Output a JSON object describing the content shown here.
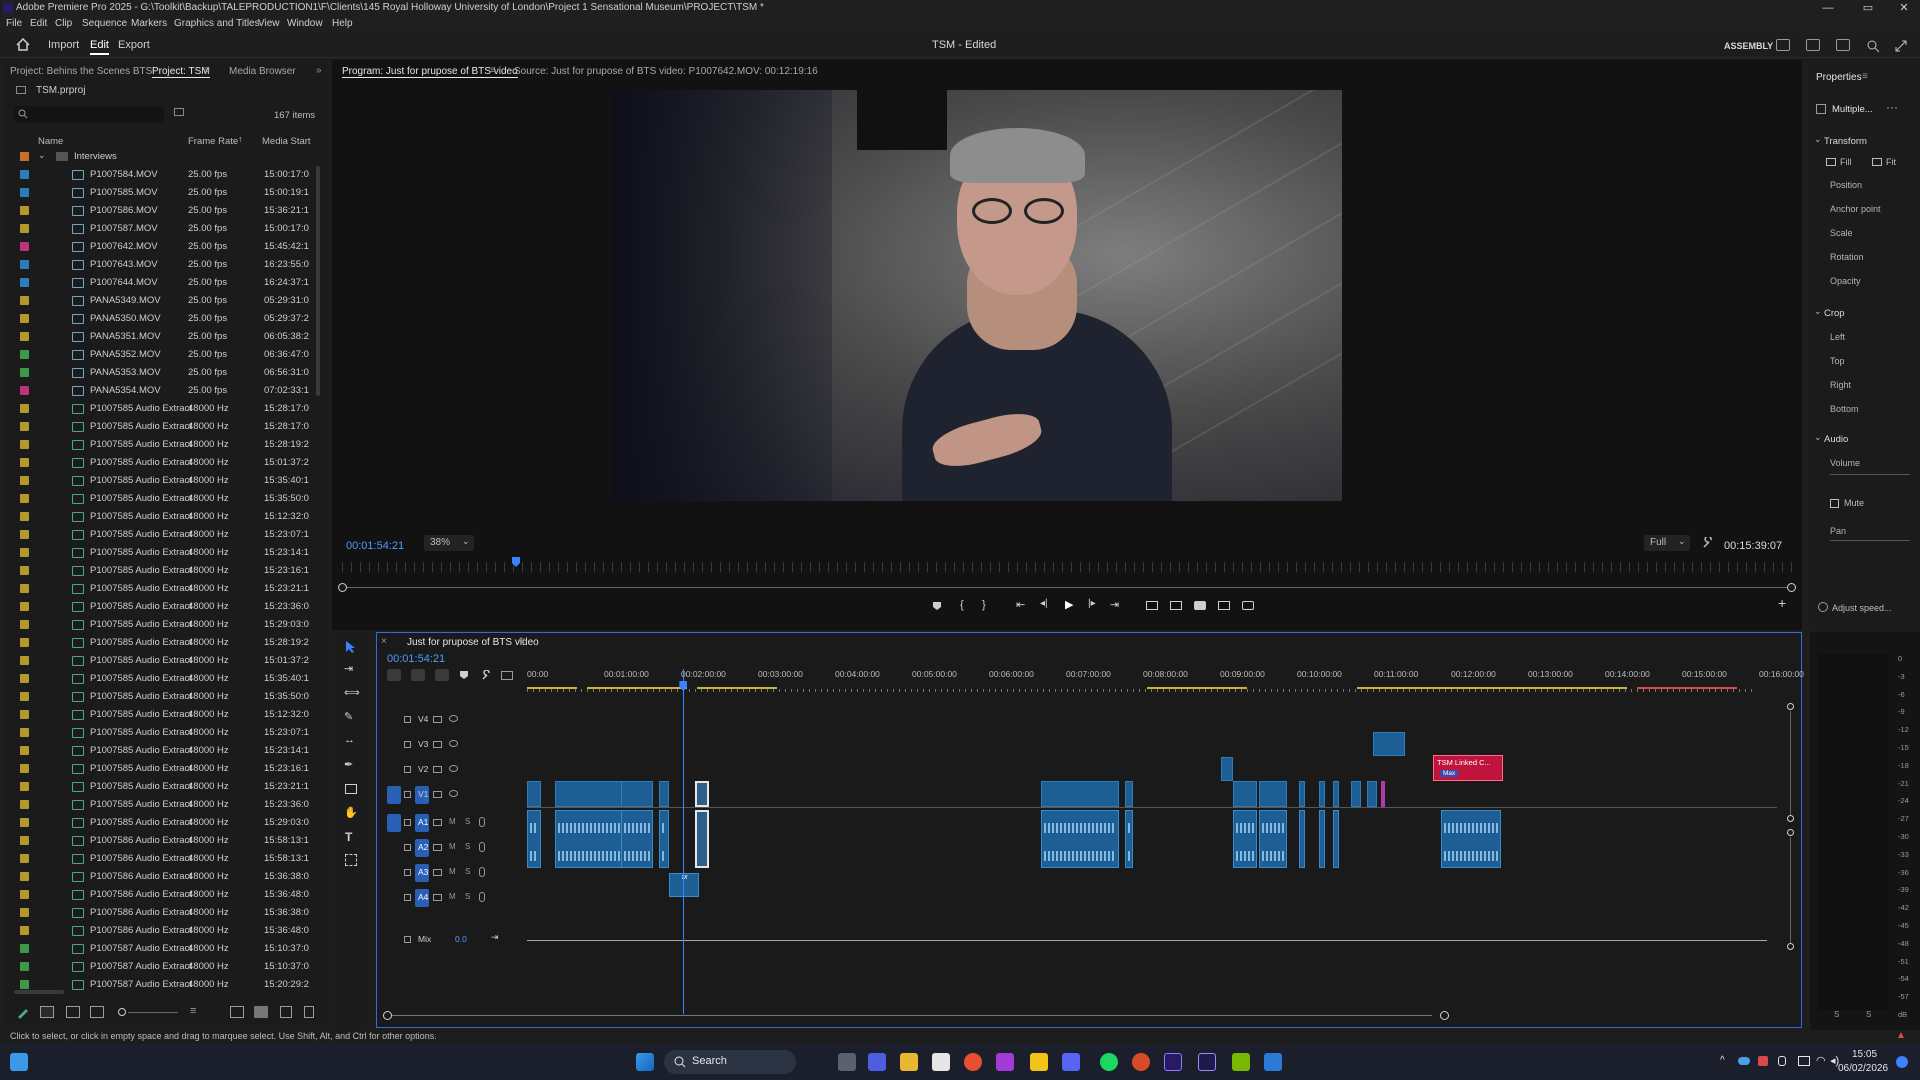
{
  "window": {
    "title": "Adobe Premiere Pro 2025 - G:\\Toolkit\\Backup\\TALEPRODUCTION1\\F\\Clients\\145 Royal Holloway University of London\\Project 1 Sensational Museum\\PROJECT\\TSM *",
    "minimize": "—",
    "maximize": "▭",
    "close": "✕"
  },
  "menu": [
    "File",
    "Edit",
    "Clip",
    "Sequence",
    "Markers",
    "Graphics and Titles",
    "View",
    "Window",
    "Help"
  ],
  "workspace": {
    "tabs": [
      "Import",
      "Edit",
      "Export"
    ],
    "active_tab": "Edit",
    "doc_title": "TSM - Edited",
    "workspace_name": "ASSEMBLY"
  },
  "project_panel": {
    "tabs": [
      "Project: Behins the Scenes BTS",
      "Project: TSM",
      "Media Browser"
    ],
    "active_tab": "Project: TSM",
    "project_file": "TSM.prproj",
    "item_count": "167 items",
    "columns": [
      "Name",
      "Frame Rate",
      "Media Start"
    ],
    "folder": "Interviews",
    "rows": [
      {
        "name": "P1007584.MOV",
        "rate": "25.00 fps",
        "start": "15:00:17:0",
        "color": "#2a7fb8",
        "type": "video"
      },
      {
        "name": "P1007585.MOV",
        "rate": "25.00 fps",
        "start": "15:00:19:1",
        "color": "#2a7fb8",
        "type": "video"
      },
      {
        "name": "P1007586.MOV",
        "rate": "25.00 fps",
        "start": "15:36:21:1",
        "color": "#b49a2a",
        "type": "video"
      },
      {
        "name": "P1007587.MOV",
        "rate": "25.00 fps",
        "start": "15:00:17:0",
        "color": "#b49a2a",
        "type": "video"
      },
      {
        "name": "P1007642.MOV",
        "rate": "25.00 fps",
        "start": "15:45:42:1",
        "color": "#c0337a",
        "type": "video"
      },
      {
        "name": "P1007643.MOV",
        "rate": "25.00 fps",
        "start": "16:23:55:0",
        "color": "#2a7fb8",
        "type": "video"
      },
      {
        "name": "P1007644.MOV",
        "rate": "25.00 fps",
        "start": "16:24:37:1",
        "color": "#2a7fb8",
        "type": "video"
      },
      {
        "name": "PANA5349.MOV",
        "rate": "25.00 fps",
        "start": "05:29:31:0",
        "color": "#b49a2a",
        "type": "video"
      },
      {
        "name": "PANA5350.MOV",
        "rate": "25.00 fps",
        "start": "05:29:37:2",
        "color": "#b49a2a",
        "type": "video"
      },
      {
        "name": "PANA5351.MOV",
        "rate": "25.00 fps",
        "start": "06:05:38:2",
        "color": "#b49a2a",
        "type": "video"
      },
      {
        "name": "PANA5352.MOV",
        "rate": "25.00 fps",
        "start": "06:36:47:0",
        "color": "#3a9a4a",
        "type": "video"
      },
      {
        "name": "PANA5353.MOV",
        "rate": "25.00 fps",
        "start": "06:56:31:0",
        "color": "#3a9a4a",
        "type": "video"
      },
      {
        "name": "PANA5354.MOV",
        "rate": "25.00 fps",
        "start": "07:02:33:1",
        "color": "#c0337a",
        "type": "video"
      },
      {
        "name": "P1007585 Audio Extract",
        "rate": "48000 Hz",
        "start": "15:28:17:0",
        "color": "#b49a2a",
        "type": "audio"
      },
      {
        "name": "P1007585 Audio Extract",
        "rate": "48000 Hz",
        "start": "15:28:17:0",
        "color": "#b49a2a",
        "type": "audio"
      },
      {
        "name": "P1007585 Audio Extract",
        "rate": "48000 Hz",
        "start": "15:28:19:2",
        "color": "#b49a2a",
        "type": "audio"
      },
      {
        "name": "P1007585 Audio Extract",
        "rate": "48000 Hz",
        "start": "15:01:37:2",
        "color": "#b49a2a",
        "type": "audio"
      },
      {
        "name": "P1007585 Audio Extract",
        "rate": "48000 Hz",
        "start": "15:35:40:1",
        "color": "#b49a2a",
        "type": "audio"
      },
      {
        "name": "P1007585 Audio Extract",
        "rate": "48000 Hz",
        "start": "15:35:50:0",
        "color": "#b49a2a",
        "type": "audio"
      },
      {
        "name": "P1007585 Audio Extract",
        "rate": "48000 Hz",
        "start": "15:12:32:0",
        "color": "#b49a2a",
        "type": "audio"
      },
      {
        "name": "P1007585 Audio Extract",
        "rate": "48000 Hz",
        "start": "15:23:07:1",
        "color": "#b49a2a",
        "type": "audio"
      },
      {
        "name": "P1007585 Audio Extract",
        "rate": "48000 Hz",
        "start": "15:23:14:1",
        "color": "#b49a2a",
        "type": "audio"
      },
      {
        "name": "P1007585 Audio Extract",
        "rate": "48000 Hz",
        "start": "15:23:16:1",
        "color": "#b49a2a",
        "type": "audio"
      },
      {
        "name": "P1007585 Audio Extract",
        "rate": "48000 Hz",
        "start": "15:23:21:1",
        "color": "#b49a2a",
        "type": "audio"
      },
      {
        "name": "P1007585 Audio Extract",
        "rate": "48000 Hz",
        "start": "15:23:36:0",
        "color": "#b49a2a",
        "type": "audio"
      },
      {
        "name": "P1007585 Audio Extract",
        "rate": "48000 Hz",
        "start": "15:29:03:0",
        "color": "#b49a2a",
        "type": "audio"
      },
      {
        "name": "P1007585 Audio Extract",
        "rate": "48000 Hz",
        "start": "15:28:19:2",
        "color": "#b49a2a",
        "type": "audio"
      },
      {
        "name": "P1007585 Audio Extract",
        "rate": "48000 Hz",
        "start": "15:01:37:2",
        "color": "#b49a2a",
        "type": "audio"
      },
      {
        "name": "P1007585 Audio Extract",
        "rate": "48000 Hz",
        "start": "15:35:40:1",
        "color": "#b49a2a",
        "type": "audio"
      },
      {
        "name": "P1007585 Audio Extract",
        "rate": "48000 Hz",
        "start": "15:35:50:0",
        "color": "#b49a2a",
        "type": "audio"
      },
      {
        "name": "P1007585 Audio Extract",
        "rate": "48000 Hz",
        "start": "15:12:32:0",
        "color": "#b49a2a",
        "type": "audio"
      },
      {
        "name": "P1007585 Audio Extract",
        "rate": "48000 Hz",
        "start": "15:23:07:1",
        "color": "#b49a2a",
        "type": "audio"
      },
      {
        "name": "P1007585 Audio Extract",
        "rate": "48000 Hz",
        "start": "15:23:14:1",
        "color": "#b49a2a",
        "type": "audio"
      },
      {
        "name": "P1007585 Audio Extract",
        "rate": "48000 Hz",
        "start": "15:23:16:1",
        "color": "#b49a2a",
        "type": "audio"
      },
      {
        "name": "P1007585 Audio Extract",
        "rate": "48000 Hz",
        "start": "15:23:21:1",
        "color": "#b49a2a",
        "type": "audio"
      },
      {
        "name": "P1007585 Audio Extract",
        "rate": "48000 Hz",
        "start": "15:23:36:0",
        "color": "#b49a2a",
        "type": "audio"
      },
      {
        "name": "P1007585 Audio Extract",
        "rate": "48000 Hz",
        "start": "15:29:03:0",
        "color": "#b49a2a",
        "type": "audio"
      },
      {
        "name": "P1007586 Audio Extract",
        "rate": "48000 Hz",
        "start": "15:58:13:1",
        "color": "#b49a2a",
        "type": "audio"
      },
      {
        "name": "P1007586 Audio Extract",
        "rate": "48000 Hz",
        "start": "15:58:13:1",
        "color": "#b49a2a",
        "type": "audio"
      },
      {
        "name": "P1007586 Audio Extract",
        "rate": "48000 Hz",
        "start": "15:36:38:0",
        "color": "#b49a2a",
        "type": "audio"
      },
      {
        "name": "P1007586 Audio Extract",
        "rate": "48000 Hz",
        "start": "15:36:48:0",
        "color": "#b49a2a",
        "type": "audio"
      },
      {
        "name": "P1007586 Audio Extract",
        "rate": "48000 Hz",
        "start": "15:36:38:0",
        "color": "#b49a2a",
        "type": "audio"
      },
      {
        "name": "P1007586 Audio Extract",
        "rate": "48000 Hz",
        "start": "15:36:48:0",
        "color": "#b49a2a",
        "type": "audio"
      },
      {
        "name": "P1007587 Audio Extract",
        "rate": "48000 Hz",
        "start": "15:10:37:0",
        "color": "#3a9a4a",
        "type": "audio"
      },
      {
        "name": "P1007587 Audio Extract",
        "rate": "48000 Hz",
        "start": "15:10:37:0",
        "color": "#3a9a4a",
        "type": "audio"
      },
      {
        "name": "P1007587 Audio Extract",
        "rate": "48000 Hz",
        "start": "15:20:29:2",
        "color": "#3a9a4a",
        "type": "audio"
      }
    ]
  },
  "program_monitor": {
    "tab": "Program: Just for prupose of BTS video",
    "source_tab": "Source: Just for prupose of BTS video: P1007642.MOV: 00:12:19:16",
    "timecode": "00:01:54:21",
    "zoom": "38%",
    "resolution": "Full",
    "duration": "00:15:39:07",
    "playhead_fraction": 0.12
  },
  "properties": {
    "title": "Properties",
    "clip": "Multiple...",
    "transform": "Transform",
    "fill": "Fill",
    "fit": "Fit",
    "position": "Position",
    "anchor": "Anchor point",
    "scale": "Scale",
    "rotation": "Rotation",
    "opacity": "Opacity",
    "crop": "Crop",
    "left": "Left",
    "top": "Top",
    "right": "Right",
    "bottom": "Bottom",
    "audio": "Audio",
    "volume": "Volume",
    "mute": "Mute",
    "pan": "Pan",
    "adjust_speed": "Adjust speed..."
  },
  "timeline": {
    "sequence_name": "Just for prupose of BTS video",
    "timecode": "00:01:54:21",
    "ruler": [
      "00:00",
      "00:01:00:00",
      "00:02:00:00",
      "00:03:00:00",
      "00:04:00:00",
      "00:05:00:00",
      "00:06:00:00",
      "00:07:00:00",
      "00:08:00:00",
      "00:09:00:00",
      "00:10:00:00",
      "00:11:00:00",
      "00:12:00:00",
      "00:13:00:00",
      "00:14:00:00",
      "00:15:00:00",
      "00:16:00:00"
    ],
    "video_tracks": [
      "V4",
      "V3",
      "V2",
      "V1"
    ],
    "audio_tracks": [
      "A1",
      "A2",
      "A3",
      "A4"
    ],
    "mix_label": "Mix",
    "mix_value": "0.0",
    "graphic_clip": "TSM Linked C...",
    "graphic_clip_sub": "Max",
    "fx_label": "fx"
  },
  "meter": {
    "scale": [
      "0",
      "-3",
      "-6",
      "-9",
      "-12",
      "-15",
      "-18",
      "-21",
      "-24",
      "-27",
      "-30",
      "-33",
      "-36",
      "-39",
      "-42",
      "-45",
      "-48",
      "-51",
      "-54",
      "-57",
      "dB"
    ],
    "channels": [
      "S",
      "S"
    ]
  },
  "status_text": "Click to select, or click in empty space and drag to marquee select. Use Shift, Alt, and Ctrl for other options.",
  "taskbar": {
    "search": "Search",
    "time": "15:05",
    "date": "06/02/2026"
  },
  "colors": {
    "accent_blue": "#2a6fd6",
    "clip_blue": "#1d5e95",
    "graphic_red": "#c1143c"
  }
}
